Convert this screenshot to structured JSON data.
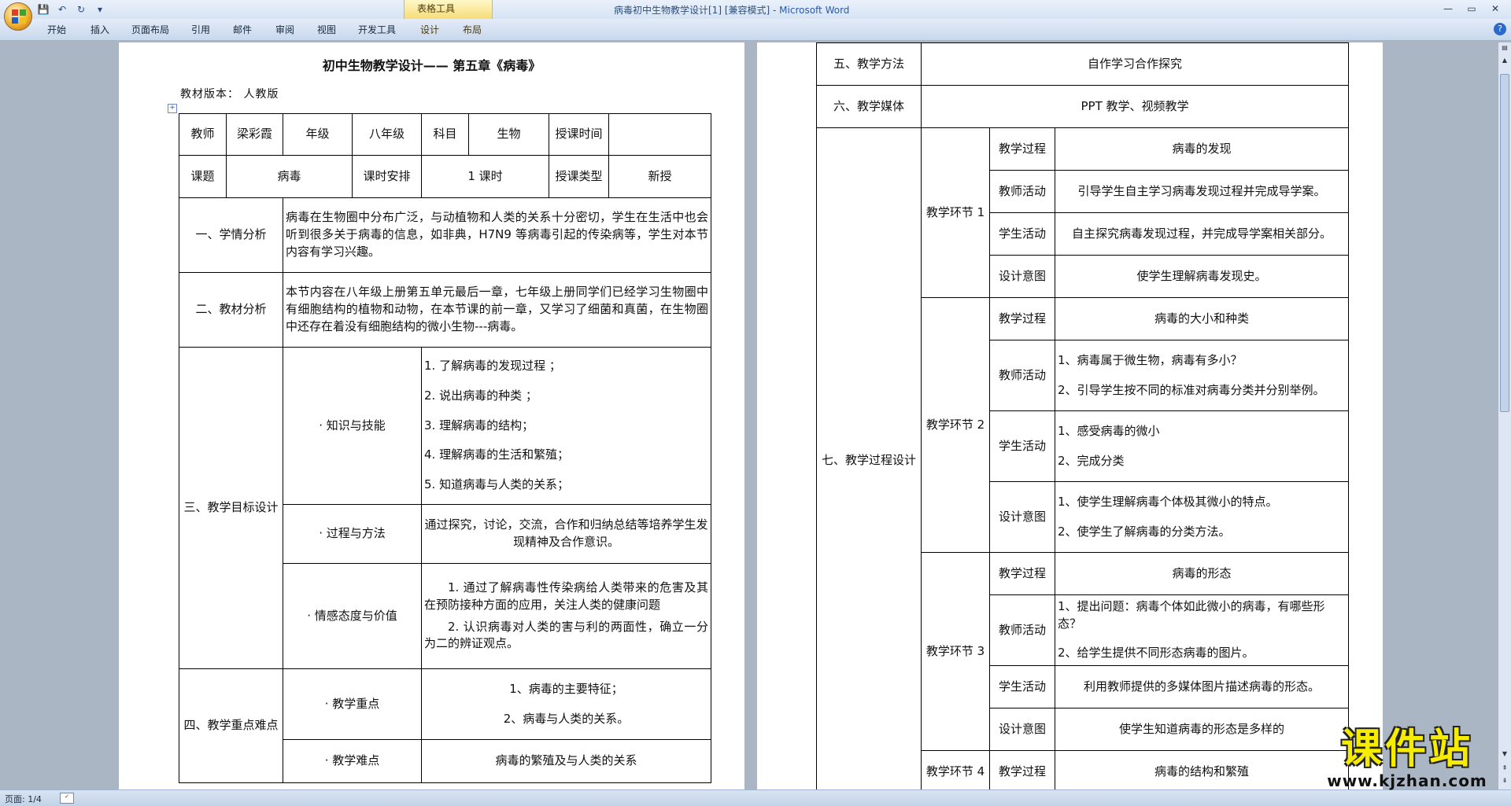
{
  "window": {
    "title": "病毒初中生物教学设计[1] [兼容模式]",
    "app_name": "Microsoft Word",
    "separator": " - "
  },
  "ribbon": {
    "tabs": [
      "开始",
      "插入",
      "页面布局",
      "引用",
      "邮件",
      "审阅",
      "视图",
      "开发工具"
    ],
    "context_group": "表格工具",
    "context_tabs": [
      "设计",
      "布局"
    ]
  },
  "doc": {
    "title": "初中生物教学设计—— 第五章《病毒》",
    "edition": "教材版本：  人教版"
  },
  "table_left": {
    "teacher_label": "教师",
    "teacher": "梁彩霞",
    "grade_label": "年级",
    "grade": "八年级",
    "subject_label": "科目",
    "subject": "生物",
    "time_label": "授课时间",
    "time_value": "",
    "topic_label": "课题",
    "topic": "病毒",
    "hours_label": "课时安排",
    "hours": "1 课时",
    "type_label": "授课类型",
    "type": "新授",
    "s1_label": "一、学情分析",
    "s1_text": "病毒在生物圈中分布广泛，与动植物和人类的关系十分密切，学生在生活中也会听到很多关于病毒的信息，如非典，H7N9 等病毒引起的传染病等，学生对本节内容有学习兴趣。",
    "s2_label": "二、教材分析",
    "s2_text": "本节内容在八年级上册第五单元最后一章，七年级上册同学们已经学习生物圈中有细胞结构的植物和动物，在本节课的前一章，又学习了细菌和真菌，在生物圈中还存在着没有细胞结构的微小生物---病毒。",
    "s3_label": "三、教学目标设计",
    "s3_knowledge_label": "· 知识与技能",
    "s3_knowledge_items": [
      "1. 了解病毒的发现过程 ；",
      "2. 说出病毒的种类 ；",
      "3.  理解病毒的结构；",
      "4. 理解病毒的生活和繁殖；",
      "5. 知道病毒与人类的关系；"
    ],
    "s3_process_label": "· 过程与方法",
    "s3_process_text": "通过探究，讨论，交流，合作和归纳总结等培养学生发现精神及合作意识。",
    "s3_emotion_label": "· 情感态度与价值",
    "s3_emotion_p1": "1. 通过了解病毒性传染病给人类带来的危害及其在预防接种方面的应用，关注人类的健康问题",
    "s3_emotion_p2": "2. 认识病毒对人类的害与利的两面性，确立一分为二的辨证观点。",
    "s4_label": "四、教学重点难点",
    "s4_key_label": "· 教学重点",
    "s4_key_items": [
      "1、病毒的主要特征；",
      "2、病毒与人类的关系。"
    ],
    "s4_diff_label": "· 教学难点",
    "s4_diff_text": "病毒的繁殖及与人类的关系"
  },
  "table_right": {
    "s5_label": "五、教学方法",
    "s5_value": "自作学习合作探究",
    "s6_label": "六、教学媒体",
    "s6_value": "PPT 教学、视频教学",
    "s7_label": "七、教学过程设计",
    "row_labels": [
      "教学过程",
      "教师活动",
      "学生活动",
      "设计意图"
    ],
    "stages": [
      {
        "name": "教学环节 1",
        "process": "病毒的发现",
        "teacher": [
          "引导学生自主学习病毒发现过程并完成导学案。"
        ],
        "student": [
          "自主探究病毒发现过程，并完成导学案相关部分。"
        ],
        "intent": [
          "使学生理解病毒发现史。"
        ]
      },
      {
        "name": "教学环节 2",
        "process": "病毒的大小和种类",
        "teacher": [
          "1、病毒属于微生物，病毒有多小？",
          "2、引导学生按不同的标准对病毒分类并分别举例。"
        ],
        "student": [
          "1、感受病毒的微小",
          "2、完成分类"
        ],
        "intent": [
          "1、使学生理解病毒个体极其微小的特点。",
          "2、使学生了解病毒的分类方法。"
        ]
      },
      {
        "name": "教学环节 3",
        "process": "病毒的形态",
        "teacher": [
          "1、提出问题：病毒个体如此微小的病毒，有哪些形态？",
          "2、给学生提供不同形态病毒的图片。"
        ],
        "student": [
          "利用教师提供的多媒体图片描述病毒的形态。"
        ],
        "intent": [
          "使学生知道病毒的形态是多样的"
        ]
      }
    ],
    "stage4_name": "教学环节 4",
    "stage4_process": "病毒的结构和繁殖"
  },
  "status": {
    "page": "页面: 1/4"
  },
  "watermark": {
    "main": "课件站",
    "url": "www.kjzhan.com"
  },
  "colors": {
    "ribbon_bg": "#dbe6f4",
    "workspace": "#aab6c4",
    "watermark_yellow": "#f6ec00"
  }
}
